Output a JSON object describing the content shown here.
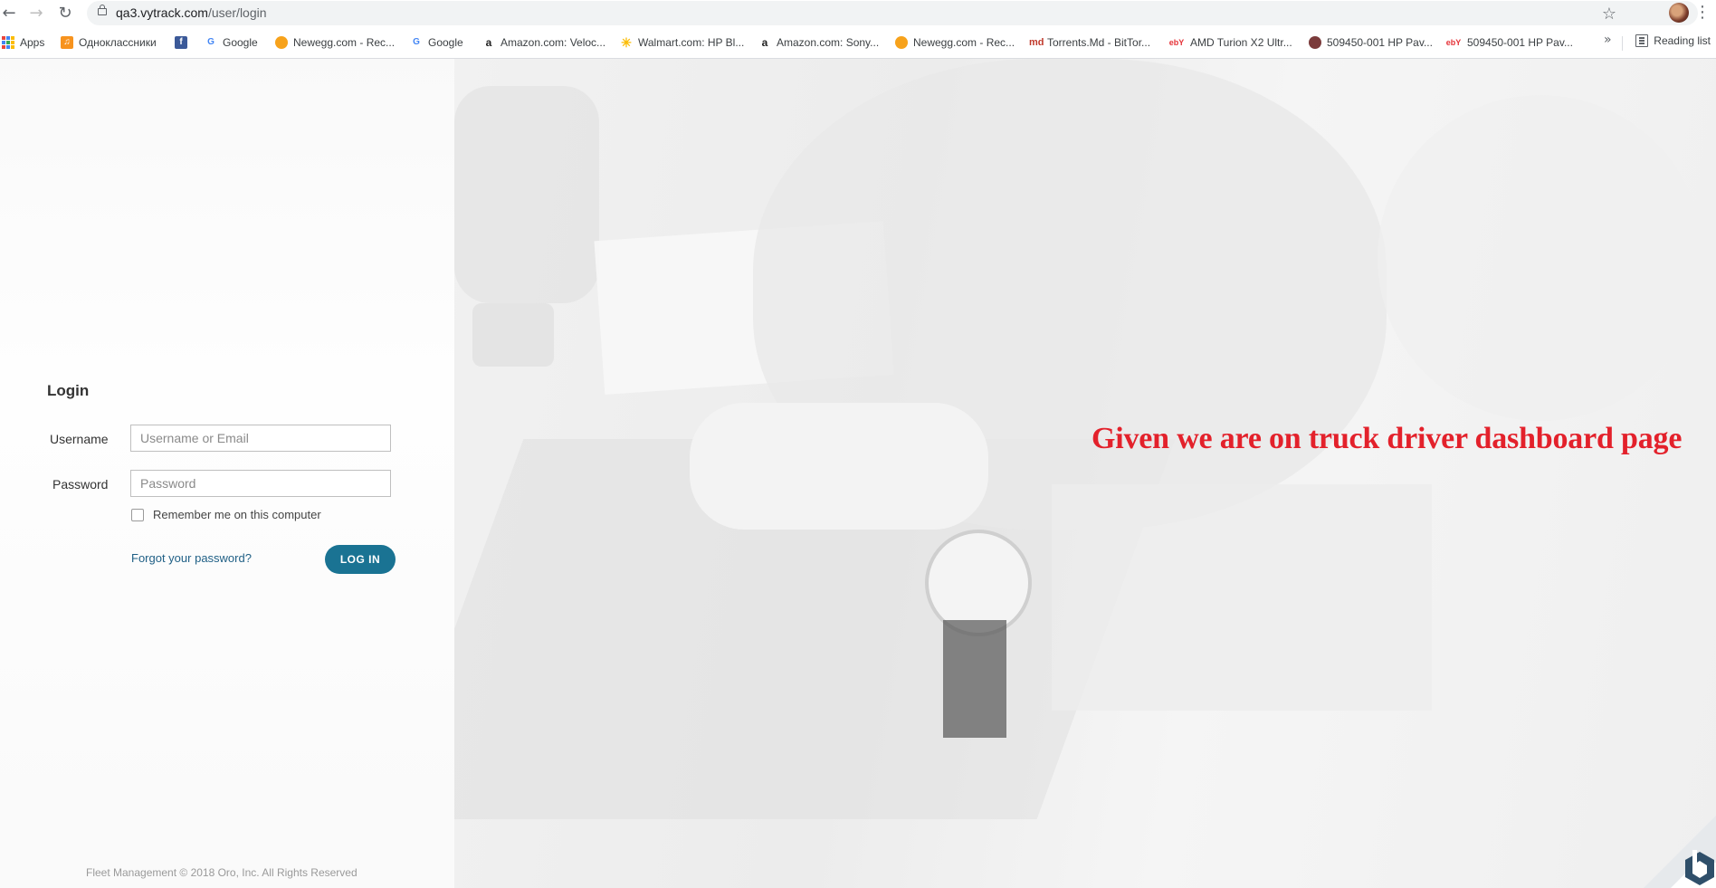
{
  "browser": {
    "url_host": "qa3.vytrack.com",
    "url_path": "/user/login",
    "bookmarks": [
      {
        "label": "Apps",
        "icon": "apps-grid-icon"
      },
      {
        "label": "Одноклассники",
        "icon": "odnoklassniki-icon"
      },
      {
        "label": "",
        "icon": "facebook-icon"
      },
      {
        "label": "Google",
        "icon": "google-icon"
      },
      {
        "label": "Newegg.com - Rec...",
        "icon": "newegg-icon"
      },
      {
        "label": "Google",
        "icon": "google-icon"
      },
      {
        "label": "Amazon.com: Veloc...",
        "icon": "amazon-icon"
      },
      {
        "label": "Walmart.com: HP Bl...",
        "icon": "walmart-icon"
      },
      {
        "label": "Amazon.com: Sony...",
        "icon": "amazon-icon"
      },
      {
        "label": "Newegg.com - Rec...",
        "icon": "newegg-icon"
      },
      {
        "label": "Torrents.Md - BitTor...",
        "icon": "torrents-md-icon"
      },
      {
        "label": "AMD Turion X2 Ultr...",
        "icon": "ebay-icon"
      },
      {
        "label": "509450-001 HP Pav...",
        "icon": "globe-icon"
      },
      {
        "label": "509450-001 HP Pav...",
        "icon": "ebay-icon"
      }
    ],
    "reading_list": "Reading list",
    "overflow": "»"
  },
  "login": {
    "title": "Login",
    "username_label": "Username",
    "username_placeholder": "Username or Email",
    "username_value": "",
    "password_label": "Password",
    "password_placeholder": "Password",
    "password_value": "",
    "remember_label": "Remember me on this computer",
    "remember_checked": false,
    "forgot_link": "Forgot your password?",
    "login_button": "LOG IN"
  },
  "footer": {
    "text": "Fleet Management © 2018 Oro, Inc. All Rights Reserved"
  },
  "overlay": {
    "text": "Given we are on truck driver dashboard page",
    "color": "#e3212b"
  },
  "colors": {
    "accent": "#1a7393",
    "link": "#1f5f85"
  }
}
